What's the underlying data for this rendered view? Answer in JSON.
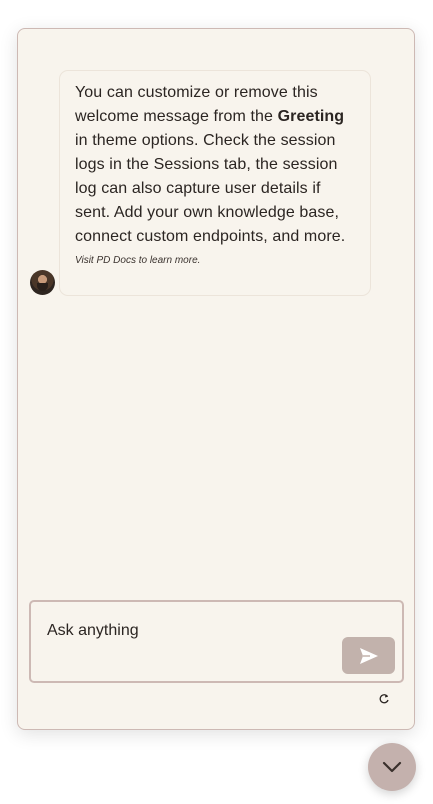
{
  "chat": {
    "greeting": {
      "before_bold": "You can customize or remove this welcome message from the ",
      "bold": "Greeting",
      "after_bold": " in theme options. Check the session logs in the Sessions tab, the session log can also capture user details if sent. Add your own knowledge base, connect custom endpoints, and more.",
      "footnote": "Visit PD Docs to learn more."
    },
    "avatar_icon": "bot-avatar"
  },
  "composer": {
    "placeholder": "Ask anything",
    "send_icon": "send-icon",
    "reset_icon": "refresh-icon"
  },
  "launcher": {
    "icon": "chevron-down-icon"
  },
  "colors": {
    "panel_bg": "#f8f4ed",
    "border": "#cdb9b4",
    "accent": "#c2b2ac",
    "text": "#2b2522"
  }
}
